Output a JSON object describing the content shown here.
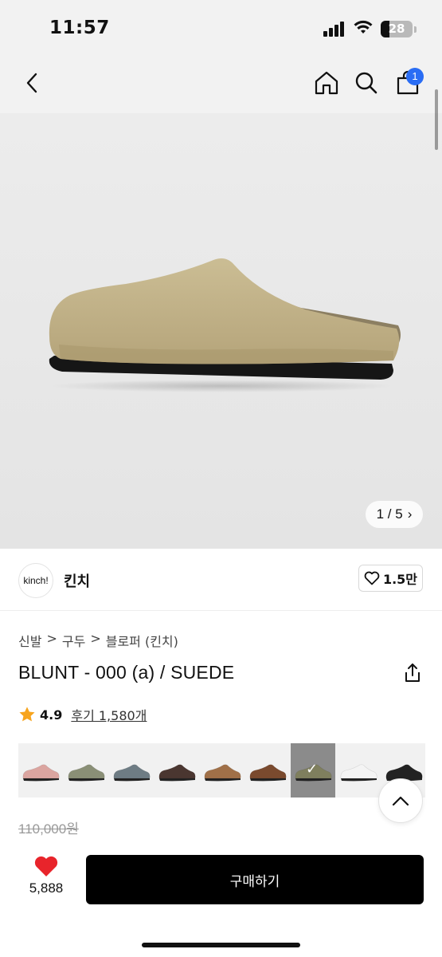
{
  "status_bar": {
    "time": "11:57",
    "battery": "28",
    "battery_level": 0.28
  },
  "nav": {
    "cart_count": "1"
  },
  "hero": {
    "image_index": "1 / 5",
    "chevron": "›"
  },
  "brand": {
    "logo_text": "kinch!",
    "name": "킨치",
    "likes": "1.5만"
  },
  "breadcrumb": [
    "신발",
    "구두",
    "블로퍼 (킨치)"
  ],
  "breadcrumb_sep": ">",
  "product": {
    "title": "BLUNT - 000 (a) / SUEDE"
  },
  "rating": {
    "score": "4.9",
    "reviews": "후기 1,580개"
  },
  "colors": {
    "swatches": [
      "#dba5a0",
      "#8a8f76",
      "#6e7c84",
      "#4a3630",
      "#a07048",
      "#7a4a2e",
      "#7f7f5e",
      "#f4f4f4",
      "#222222"
    ],
    "selected_index": 6
  },
  "price": {
    "original": "110,000원"
  },
  "bottom": {
    "wish_count": "5,888",
    "buy_label": "구매하기"
  },
  "colors_theme": {
    "accent": "#2a6df4",
    "heart": "#e8242b"
  }
}
